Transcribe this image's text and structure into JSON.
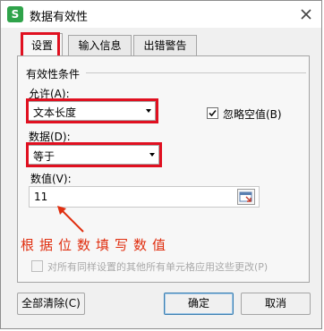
{
  "window": {
    "title": "数据有效性",
    "app_icon_letter": "S"
  },
  "tabs": [
    {
      "label": "设置",
      "active": true
    },
    {
      "label": "输入信息",
      "active": false
    },
    {
      "label": "出错警告",
      "active": false
    }
  ],
  "settings": {
    "group_title": "有效性条件",
    "allow_label": "允许(A):",
    "allow_value": "文本长度",
    "ignore_blank_label": "忽略空值(B)",
    "ignore_blank_checked": true,
    "data_label": "数据(D):",
    "data_value": "等于",
    "value_label": "数值(V):",
    "value_value": "11"
  },
  "annotation": {
    "text": "根据位数填写数值",
    "color": "#e02f10"
  },
  "apply_all": {
    "label": "对所有同样设置的其他所有单元格应用这些更改(P)",
    "checked": false,
    "enabled": false
  },
  "buttons": {
    "clear_all": "全部清除(C)",
    "ok": "确定",
    "cancel": "取消"
  },
  "colors": {
    "highlight": "#e01020",
    "app_icon": "#2fa34a"
  }
}
